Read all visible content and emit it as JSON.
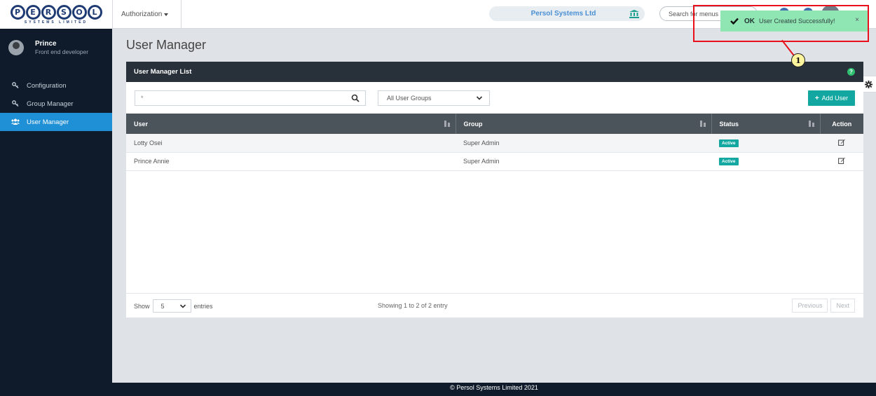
{
  "app": {
    "logo_letters": [
      "P",
      "E",
      "R",
      "S",
      "O",
      "L"
    ],
    "logo_subtitle": "SYSTEMS LIMITED"
  },
  "topbar": {
    "nav_dropdown_label": "Authorization",
    "company_name": "Persol Systems Ltd",
    "search_placeholder": "Search for menus"
  },
  "sidebar": {
    "user_name": "Prince",
    "user_role": "Front end developer",
    "items": [
      {
        "label": "Configuration",
        "icon": "key-icon",
        "active": false
      },
      {
        "label": "Group Manager",
        "icon": "key-icon",
        "active": false
      },
      {
        "label": "User Manager",
        "icon": "users-icon",
        "active": true
      }
    ]
  },
  "main": {
    "page_title": "User Manager",
    "panel_title": "User Manager List",
    "filter_placeholder": "*",
    "group_select_value": "All User Groups",
    "add_button_label": "Add User",
    "table": {
      "headers": [
        "User",
        "Group",
        "Status",
        "Action"
      ],
      "rows": [
        {
          "user": "Lotty Osei",
          "group": "Super Admin",
          "status": "Active"
        },
        {
          "user": "Prince Annie",
          "group": "Super Admin",
          "status": "Active"
        }
      ]
    },
    "footer": {
      "show_label": "Show",
      "page_size": "5",
      "entries_label": "entries",
      "info_text": "Showing 1 to 2 of 2 entry",
      "prev_label": "Previous",
      "next_label": "Next"
    }
  },
  "toast": {
    "ok_label": "OK",
    "message": "User Created Successfully!",
    "close_symbol": "×"
  },
  "annotation": {
    "number": "1"
  },
  "copyright": "© Persol Systems Limited 2021",
  "colors": {
    "sidebar_bg": "#0f1b2a",
    "accent_blue": "#1f8fd6",
    "badge_teal": "#12a7a0",
    "toast_green": "#8fe6b3",
    "annotation_red": "#e8101a"
  }
}
